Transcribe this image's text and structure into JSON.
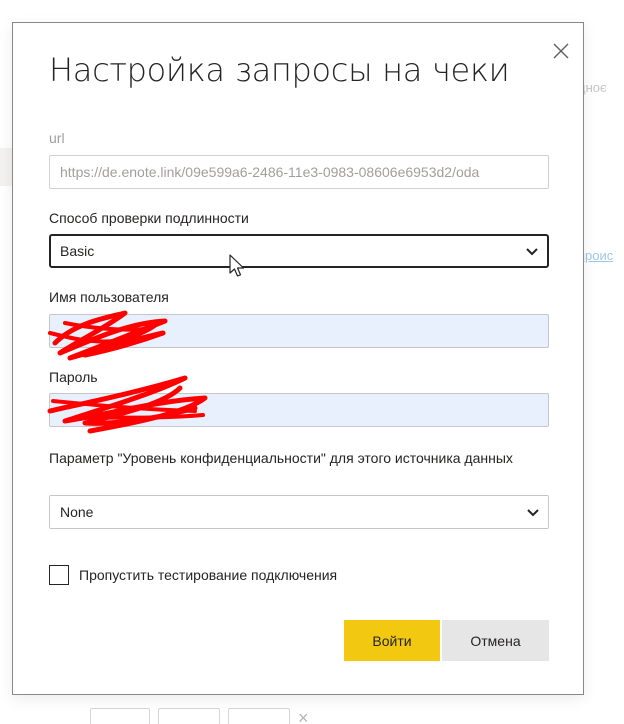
{
  "background": {
    "top_right_text": "дноє",
    "link_text": "проис"
  },
  "dialog": {
    "title": "Настройка запросы на чеки",
    "url": {
      "label": "url",
      "value": "https://de.enote.link/09e599a6-2486-11e3-0983-08606e6953d2/oda"
    },
    "auth": {
      "label": "Способ проверки подлинности",
      "selected": "Basic"
    },
    "username": {
      "label": "Имя пользователя",
      "value": ""
    },
    "password": {
      "label": "Пароль",
      "value": ""
    },
    "privacy": {
      "label": "Параметр \"Уровень конфиденциальности\" для этого источника данных",
      "selected": "None"
    },
    "skip_test": {
      "label": "Пропустить тестирование подключения",
      "checked": false
    },
    "buttons": {
      "primary": "Войти",
      "secondary": "Отмена"
    }
  },
  "colors": {
    "accent": "#f2c811",
    "secondary_button": "#e6e6e6",
    "autofill": "#e8f0fe",
    "redaction": "#ff0000"
  },
  "icons": {
    "close": "close-icon",
    "chevron": "chevron-down-icon",
    "cursor": "mouse-cursor-icon"
  }
}
